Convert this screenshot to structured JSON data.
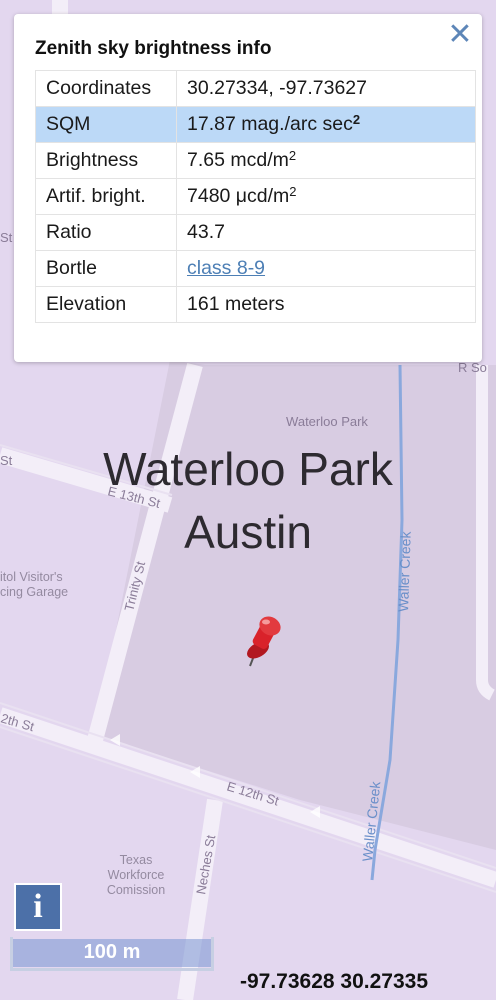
{
  "panel": {
    "title": "Zenith sky brightness info",
    "close_glyph": "✕",
    "rows": [
      {
        "key": "Coordinates",
        "value": "30.27334, -97.73627"
      },
      {
        "key": "SQM",
        "value": "17.87 mag./arc sec",
        "sup": "2"
      },
      {
        "key": "Brightness",
        "value": "7.65 mcd/m",
        "sup": "2"
      },
      {
        "key": "Artif. bright.",
        "value": "7480 μcd/m",
        "sup": "2"
      },
      {
        "key": "Ratio",
        "value": "43.7"
      },
      {
        "key": "Bortle",
        "value": "class 8-9"
      },
      {
        "key": "Elevation",
        "value": "161 meters"
      }
    ]
  },
  "map": {
    "place_name": "Waterloo Park",
    "place_city": "Austin",
    "park_label": "Waterloo Park",
    "streets": {
      "e_13th": "E 13th St",
      "e_12th": "E 12th St",
      "w_12th": "2th St",
      "trinity": "Trinity St",
      "neches": "Neches St",
      "left_st": "St",
      "left_st_2": "St",
      "right_so": "R So"
    },
    "waterway": "Waller Creek",
    "poi_visitor_1": "itol Visitor's",
    "poi_visitor_2": "cing Garage",
    "poi_texas_1": "Texas",
    "poi_texas_2": "Workforce",
    "poi_texas_3": "Comission",
    "colors": {
      "background": "#e3d7ef",
      "park": "#d8cce2",
      "water": "#8aa8dd",
      "pin": "#d9222a"
    }
  },
  "controls": {
    "info_label": "i",
    "scale_label": "100 m",
    "coords_readout": "-97.73628 30.27335"
  },
  "icons": {
    "info": "info-icon",
    "pin": "map-pin-icon",
    "close": "close-icon"
  }
}
